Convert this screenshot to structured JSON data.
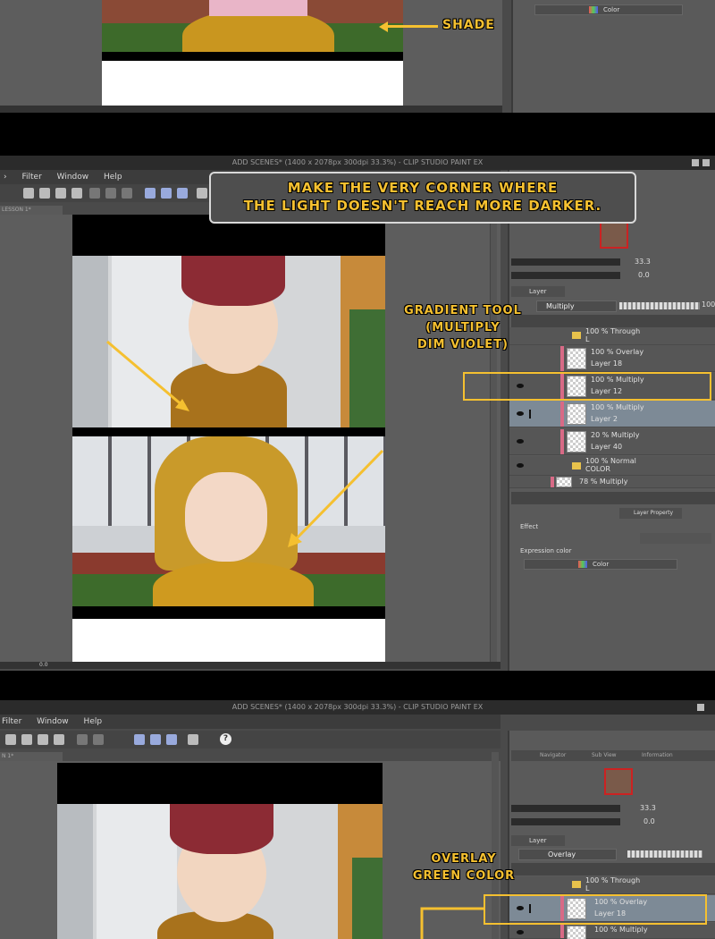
{
  "app": {
    "title": "ADD SCENES* (1400 x 2078px 300dpi 33.3%)  - CLIP STUDIO PAINT EX"
  },
  "menu": {
    "filter": "Filter",
    "window": "Window",
    "help": "Help"
  },
  "canvas_tab": "LESSON 1*",
  "canvas_tab_short": "N 1*",
  "navigator": {
    "tabs": [
      "Navigator",
      "Sub View",
      "Information"
    ],
    "zoom": "33.3",
    "angle": "0.0"
  },
  "layer_panel": {
    "tab_label": "Layer",
    "blend_mode": "Multiply",
    "blend_mode_overlay": "Overlay",
    "opacity": "100",
    "layers": [
      {
        "mode": "100 %  Through",
        "name": "L"
      },
      {
        "mode": "100 %  Overlay",
        "name": "Layer 18"
      },
      {
        "mode": "100 %  Multiply",
        "name": "Layer 12"
      },
      {
        "mode": "100 %  Multiply",
        "name": "Layer 2"
      },
      {
        "mode": "20 %  Multiply",
        "name": "Layer 40"
      },
      {
        "mode": "100 %  Normal",
        "name": "COLOR"
      },
      {
        "mode": "78 %  Multiply",
        "name": ""
      }
    ]
  },
  "property_panel": {
    "tab_label": "Layer Property",
    "effect_label": "Effect",
    "expression_color_label": "Expression color",
    "expression_color_value": "Color"
  },
  "status": {
    "zoom": "0.0"
  },
  "annotations": {
    "shade": "Shade",
    "corner_note": "Make the very corner where\nthe light doesn't reach more darker.",
    "gradient_tool": "Gradient tool\n(Multiply\ndim violet)",
    "overlay": "Overlay\ngreen color"
  },
  "colors": {
    "accent": "#f5c030",
    "selected_layer": "#7d8a96",
    "layer_tag": "#d86a86"
  }
}
